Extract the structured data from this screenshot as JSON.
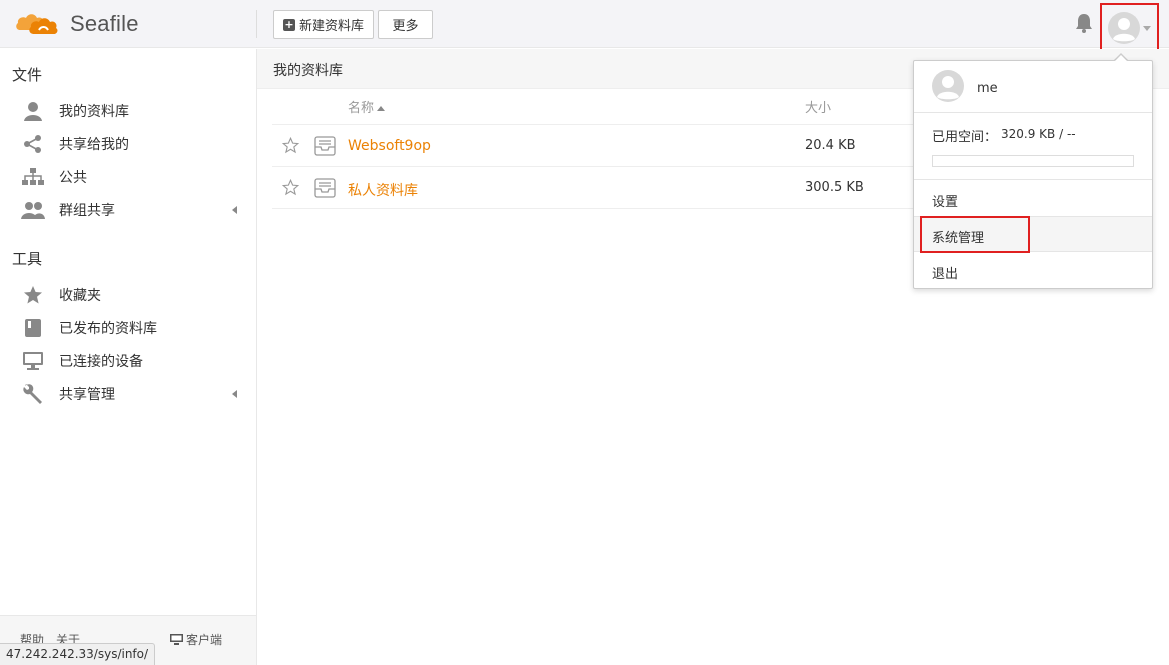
{
  "header": {
    "logo_text": "Seafile",
    "new_library_label": "新建资料库",
    "more_label": "更多"
  },
  "sidebar": {
    "files_heading": "文件",
    "files_items": [
      {
        "label": "我的资料库",
        "icon": "user-icon"
      },
      {
        "label": "共享给我的",
        "icon": "share-icon"
      },
      {
        "label": "公共",
        "icon": "sitemap-icon"
      },
      {
        "label": "群组共享",
        "icon": "group-icon"
      }
    ],
    "tools_heading": "工具",
    "tools_items": [
      {
        "label": "收藏夹",
        "icon": "star-icon"
      },
      {
        "label": "已发布的资料库",
        "icon": "book-icon"
      },
      {
        "label": "已连接的设备",
        "icon": "monitor-icon"
      },
      {
        "label": "共享管理",
        "icon": "wrench-icon"
      }
    ],
    "footer": {
      "help": "帮助",
      "about": "关于",
      "client": "客户端"
    },
    "status_url": "47.242.242.33/sys/info/"
  },
  "main": {
    "title": "我的资料库",
    "columns": {
      "name": "名称",
      "size": "大小"
    },
    "rows": [
      {
        "name": "Websoft9op",
        "size": "20.4 KB"
      },
      {
        "name": "私人资料库",
        "size": "300.5 KB"
      }
    ]
  },
  "dropdown": {
    "username": "me",
    "space_label": "已用空间：",
    "space_value": "320.9 KB / --",
    "space_fraction": 0,
    "settings": "设置",
    "sys_admin": "系统管理",
    "logout": "退出"
  },
  "colors": {
    "accent": "#eb8205",
    "highlight_box": "#e02020"
  }
}
